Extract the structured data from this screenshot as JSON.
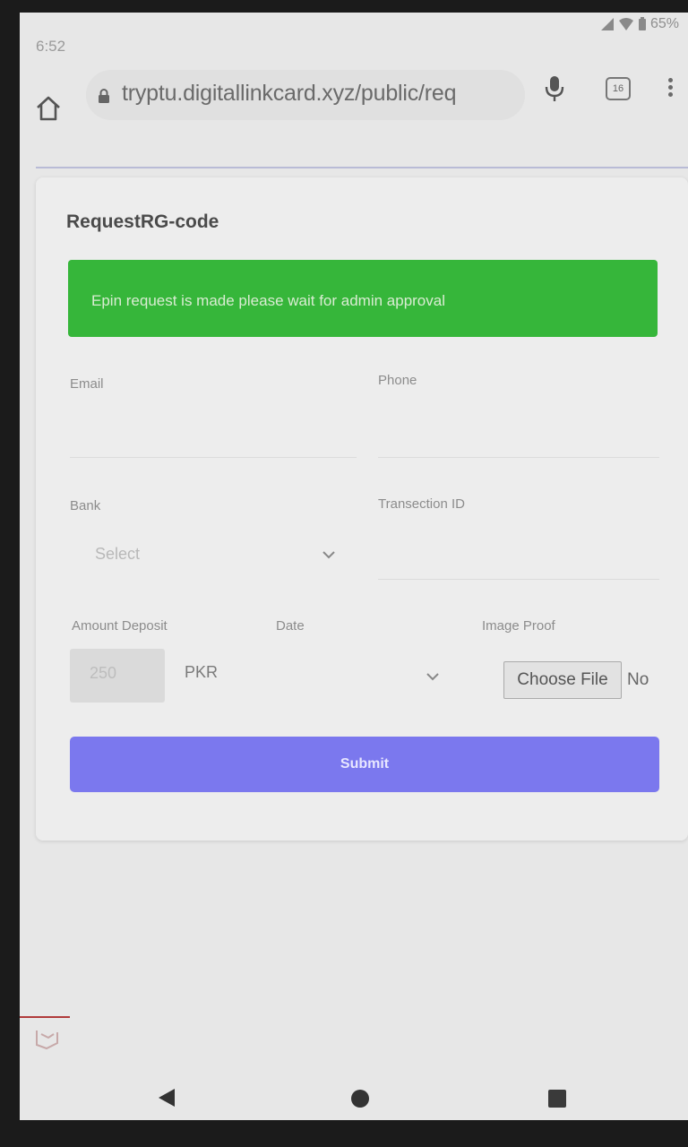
{
  "status_bar": {
    "time": "6:52",
    "battery": "65%",
    "icons": [
      "signal-icon",
      "wifi-icon",
      "battery-icon"
    ]
  },
  "browser": {
    "url": "tryptu.digitallinkcard.xyz/public/req",
    "tab_count": "16",
    "icons": [
      "home-icon",
      "lock-icon",
      "mic-icon",
      "tabs-icon",
      "overflow-menu-icon"
    ]
  },
  "form": {
    "title": "RequestRG-code",
    "alert": "Epin request is made please wait for admin approval",
    "email_label": "Email",
    "phone_label": "Phone",
    "bank_label": "Bank",
    "bank_value": "Select",
    "transaction_label": "Transection ID",
    "amount_label": "Amount Deposit",
    "amount_value": "250",
    "currency": "PKR",
    "date_label": "Date",
    "image_label": "Image Proof",
    "file_button": "Choose File",
    "file_status": "No",
    "submit_label": "Submit"
  },
  "colors": {
    "alert_bg": "#36b63a",
    "submit_bg": "#7b78ee"
  }
}
